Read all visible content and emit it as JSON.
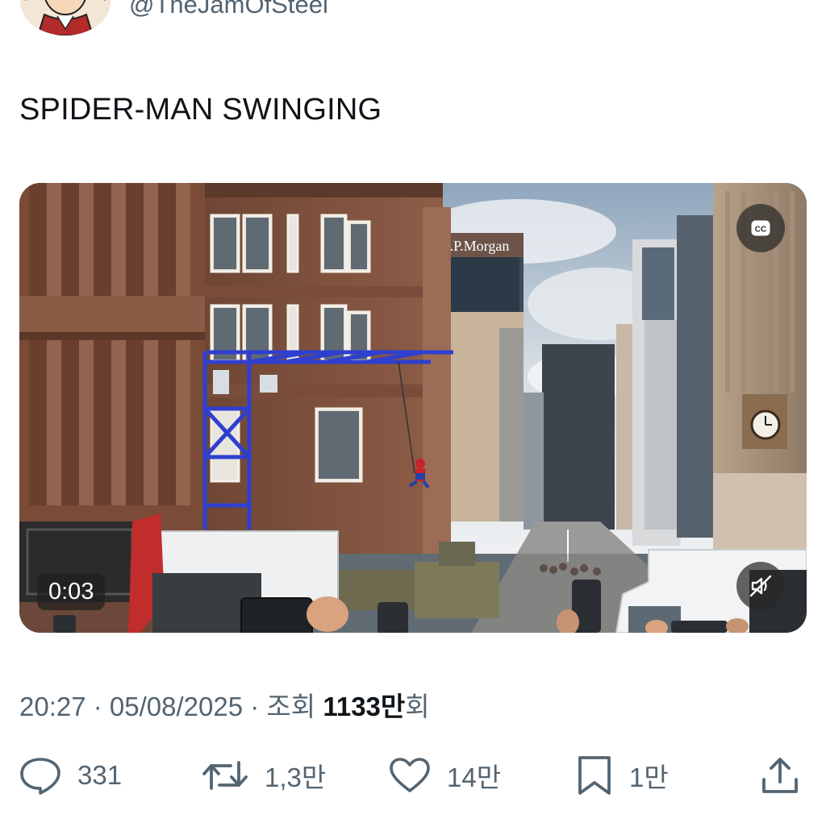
{
  "header": {
    "handle": "@TheJamOfSteel",
    "avatar_icon": "avatar-icon"
  },
  "tweet": {
    "text": "SPIDER-MAN SWINGING"
  },
  "video": {
    "time": "0:03",
    "cc_icon": "cc-icon",
    "cc_label": "CC",
    "mute_icon": "muted-speaker-icon",
    "sign_text": "J.P.Morgan"
  },
  "meta": {
    "timestamp": "20:27 · 05/08/2025",
    "separator": " · ",
    "views_label": "조회",
    "views_count": "1133만",
    "views_suffix": "회"
  },
  "actions": {
    "reply": {
      "icon": "reply-icon",
      "count": "331"
    },
    "retweet": {
      "icon": "retweet-icon",
      "count": "1,3만"
    },
    "like": {
      "icon": "heart-icon",
      "count": "14만"
    },
    "bookmark": {
      "icon": "bookmark-icon",
      "count": "1만"
    },
    "share": {
      "icon": "share-icon"
    }
  },
  "colors": {
    "text_primary": "#0f1419",
    "text_secondary": "#536471",
    "scaffold_blue": "#2f3fd0",
    "sandstone": "#8a5a44"
  }
}
